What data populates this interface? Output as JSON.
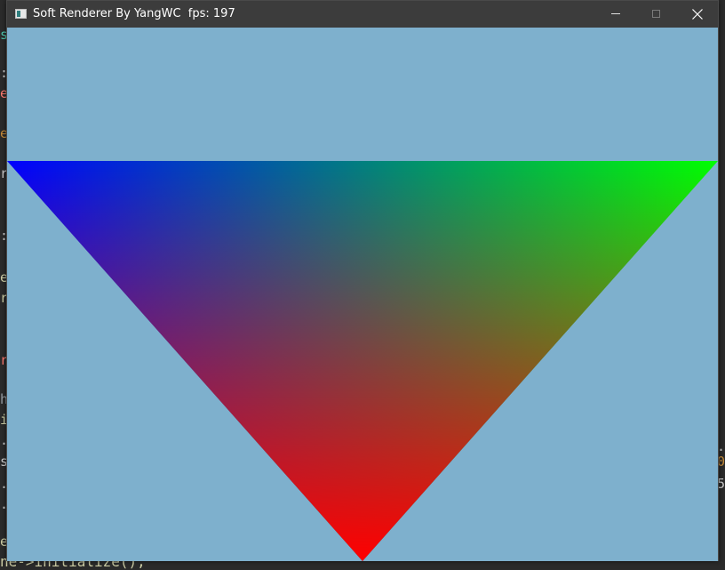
{
  "window": {
    "title": "Soft Renderer By YangWC  fps: 197",
    "clear_color": "#7eb0cd"
  },
  "titlebar_buttons": {
    "minimize_icon": "minimize-icon",
    "maximize_icon": "maximize-icon",
    "close_icon": "close-icon"
  },
  "scene": {
    "triangle": {
      "vertex_colors": [
        "#0000ff",
        "#00ff00",
        "#ff0000"
      ]
    }
  },
  "background_editor": {
    "left_fragments": [
      {
        "text": "s",
        "color": "#4ec9b0"
      },
      {
        "text": ":",
        "color": "#cfcfcf"
      },
      {
        "text": "e",
        "color": "#ff7b72"
      },
      {
        "text": "e",
        "color": "#c58b3a"
      },
      {
        "text": "r",
        "color": "#cfcfcf"
      },
      {
        "text": ":",
        "color": "#cfcfcf"
      },
      {
        "text": "e",
        "color": "#d0d0a8"
      },
      {
        "text": "r",
        "color": "#d0d0a8"
      },
      {
        "text": "r",
        "color": "#ff7b72"
      },
      {
        "text": "h",
        "color": "#9aa0a6"
      },
      {
        "text": "i",
        "color": "#d0d0a8"
      },
      {
        "text": ".",
        "color": "#cfcfcf"
      },
      {
        "text": "s",
        "color": "#cfcfcf"
      },
      {
        "text": ".",
        "color": "#cfcfcf"
      },
      {
        "text": ".",
        "color": "#cfcfcf"
      },
      {
        "text": "e",
        "color": "#d0d0a8"
      }
    ],
    "right_fragments": [
      {
        "text": ".",
        "color": "#cfcfcf"
      },
      {
        "text": "0",
        "color": "#c58b3a"
      },
      {
        "text": "5",
        "color": "#cfcfcf"
      }
    ],
    "bottom_line": "ne->initialize();"
  }
}
